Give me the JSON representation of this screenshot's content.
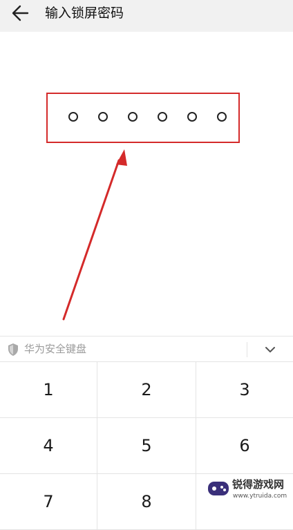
{
  "header": {
    "title": "输入锁屏密码",
    "back_icon": "arrow-left-icon"
  },
  "pin": {
    "length": 6,
    "entered": 0,
    "highlight_color": "#d42a2a"
  },
  "annotation": {
    "color": "#d42a2a",
    "icon": "red-arrow"
  },
  "keyboard": {
    "label": "华为安全键盘",
    "shield_icon": "shield-icon",
    "collapse_icon": "chevron-down-icon",
    "keys": [
      "1",
      "2",
      "3",
      "4",
      "5",
      "6",
      "7",
      "8"
    ]
  },
  "watermark": {
    "title": "锐得游戏网",
    "url": "www.ytruida.com"
  }
}
